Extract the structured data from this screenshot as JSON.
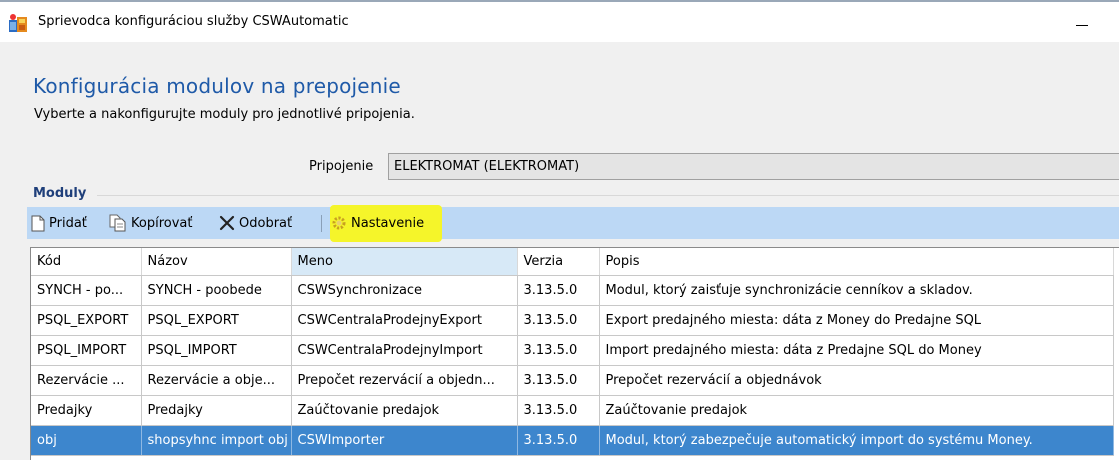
{
  "window": {
    "title": "Sprievodca konfiguráciou služby CSWAutomatic",
    "icon": "app-icon",
    "minimize_icon": "minimize-icon"
  },
  "page": {
    "heading": "Konfigurácia modulov na prepojenie",
    "subheading": "Vyberte a nakonfigurujte moduly pro jednotlivé pripojenia."
  },
  "connection": {
    "label": "Pripojenie",
    "value": "ELEKTROMAT (ELEKTROMAT)"
  },
  "modules": {
    "group_label": "Moduly",
    "toolbar": {
      "add_label": "Pridať",
      "copy_label": "Kopírovať",
      "remove_label": "Odobrať",
      "settings_label": "Nastavenie",
      "highlight_color": "#f5f52a"
    },
    "columns": [
      "Kód",
      "Názov",
      "Meno",
      "Verzia",
      "Popis"
    ],
    "rows": [
      [
        "SYNCH - po...",
        "SYNCH - poobede",
        "CSWSynchronizace",
        "3.13.5.0",
        "Modul, ktorý zaisťuje synchronizácie cenníkov a skladov."
      ],
      [
        "PSQL_EXPORT",
        "PSQL_EXPORT",
        "CSWCentralaProdejnyExport",
        "3.13.5.0",
        "Export predajného miesta: dáta z Money do Predajne SQL"
      ],
      [
        "PSQL_IMPORT",
        "PSQL_IMPORT",
        "CSWCentralaProdejnyImport",
        "3.13.5.0",
        "Import predajného miesta: dáta z Predajne SQL do Money"
      ],
      [
        "Rezervácie ...",
        "Rezervácie a obje...",
        "Prepočet rezervácií a objedn...",
        "3.13.5.0",
        "Prepočet rezervácií a objednávok"
      ],
      [
        "Predajky",
        "Predajky",
        "Zaúčtovanie predajok",
        "3.13.5.0",
        "Zaúčtovanie predajok"
      ],
      [
        "obj",
        "shopsyhnc import obj",
        "CSWImporter",
        "3.13.5.0",
        "Modul, ktorý zabezpečuje automatický import do systému Money."
      ]
    ],
    "selected_row": 5,
    "selection_color": "#3d86cd"
  }
}
